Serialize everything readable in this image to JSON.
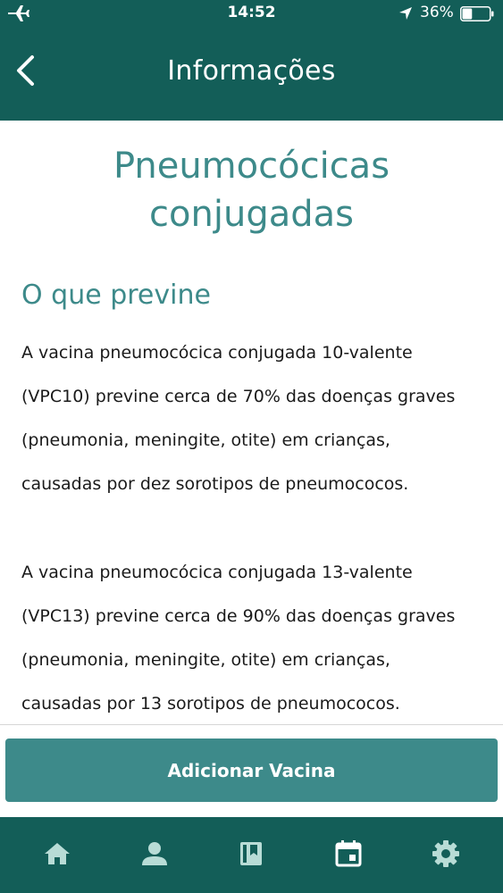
{
  "status_bar": {
    "time": "14:52",
    "battery_percent": "36%",
    "battery_level": 0.36,
    "icons": [
      "airplane-icon",
      "location-arrow-icon",
      "battery-icon"
    ]
  },
  "header": {
    "title": "Informações",
    "back_icon": "chevron-left-icon"
  },
  "main": {
    "title": "Pneumocócicas\nconjugadas",
    "section_title": "O que previne",
    "paragraphs": [
      "A vacina pneumocócica conjugada 10-valente\n(VPC10) previne cerca de 70% das doenças graves\n(pneumonia, meningite, otite) em crianças,\ncausadas por dez sorotipos de pneumococos.",
      "A vacina pneumocócica conjugada 13-valente\n(VPC13) previne cerca de 90% das doenças graves\n(pneumonia, meningite, otite) em crianças,\ncausadas por 13 sorotipos de pneumococos."
    ]
  },
  "action": {
    "add_label": "Adicionar Vacina"
  },
  "tabbar": {
    "items": [
      {
        "icon": "home-icon"
      },
      {
        "icon": "person-icon"
      },
      {
        "icon": "book-icon"
      },
      {
        "icon": "calendar-icon"
      },
      {
        "icon": "gear-icon"
      }
    ]
  },
  "colors": {
    "header_bg": "#135e58",
    "accent": "#3d8a8a",
    "text": "#1a1a1a",
    "icon_light": "#b8dcd6"
  }
}
